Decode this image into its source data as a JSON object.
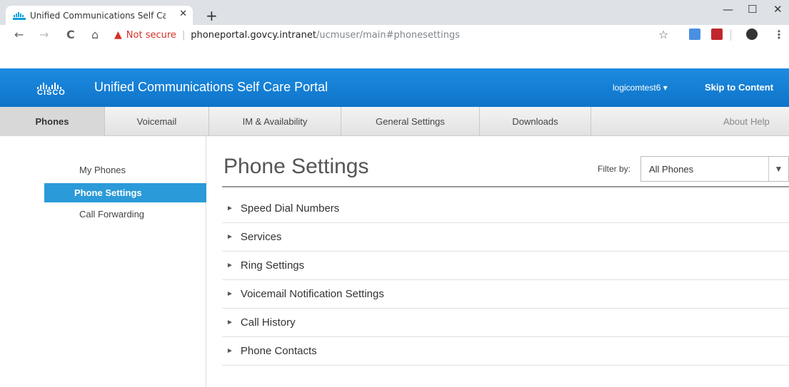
{
  "browser": {
    "tab_title": "Unified Communications Self Car",
    "tab_close": "✕",
    "new_tab": "+",
    "minimize": "—",
    "maximize": "☐",
    "close": "✕",
    "back": "←",
    "forward": "→",
    "reload": "C",
    "home": "⌂",
    "warning_icon": "▲",
    "not_secure": "Not secure",
    "separator": "|",
    "url_host": "phoneportal.govcy.intranet",
    "url_path": "/ucmuser/main#phonesettings",
    "bookmark": "☆",
    "menu": "⋮"
  },
  "header": {
    "logo_text": "CISCO",
    "title": "Unified Communications Self Care Portal",
    "user": "logicomtest6 ▾",
    "skip_link": "Skip to Content"
  },
  "nav": {
    "tabs": [
      "Phones",
      "Voicemail",
      "IM & Availability",
      "General Settings",
      "Downloads"
    ],
    "active": "Phones",
    "about": "About",
    "help": "Help"
  },
  "sidebar": {
    "items": [
      "My Phones",
      "Phone Settings",
      "Call Forwarding"
    ],
    "active": "Phone Settings"
  },
  "main": {
    "title": "Phone Settings",
    "filter_label": "Filter by:",
    "filter_value": "All Phones",
    "filter_caret": "▼",
    "sections": [
      "Speed Dial Numbers",
      "Services",
      "Ring Settings",
      "Voicemail Notification Settings",
      "Call History",
      "Phone Contacts"
    ],
    "expand_glyph": "►"
  },
  "colors": {
    "header_blue": "#0e74c9",
    "active_blue": "#2b9ad8",
    "warning_red": "#d93025"
  }
}
